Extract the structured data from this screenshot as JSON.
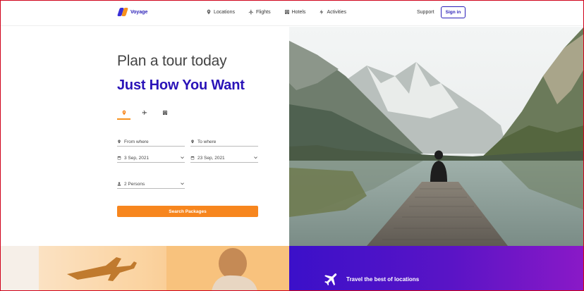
{
  "brand": {
    "name": "Voyage"
  },
  "nav": {
    "links": [
      "Locations",
      "Flights",
      "Hotels",
      "Activities"
    ],
    "support": "Support",
    "signin": "Sign in"
  },
  "hero": {
    "headline": "Plan a tour today",
    "subheadline": "Just How You Want"
  },
  "search": {
    "tabs": [
      "location",
      "flight",
      "hotel"
    ],
    "active_tab": "location",
    "from_placeholder": "From where",
    "to_placeholder": "To where",
    "depart_date": "3 Sep, 2021",
    "return_date": "23 Sep, 2021",
    "persons": "2 Persons",
    "button_label": "Search Packages"
  },
  "promo": {
    "text": "Travel the best of locations"
  },
  "colors": {
    "brand_primary": "#2a13b8",
    "accent_orange": "#f7861e",
    "promo_gradient_start": "#3b10c9",
    "promo_gradient_end": "#8a19c7"
  }
}
